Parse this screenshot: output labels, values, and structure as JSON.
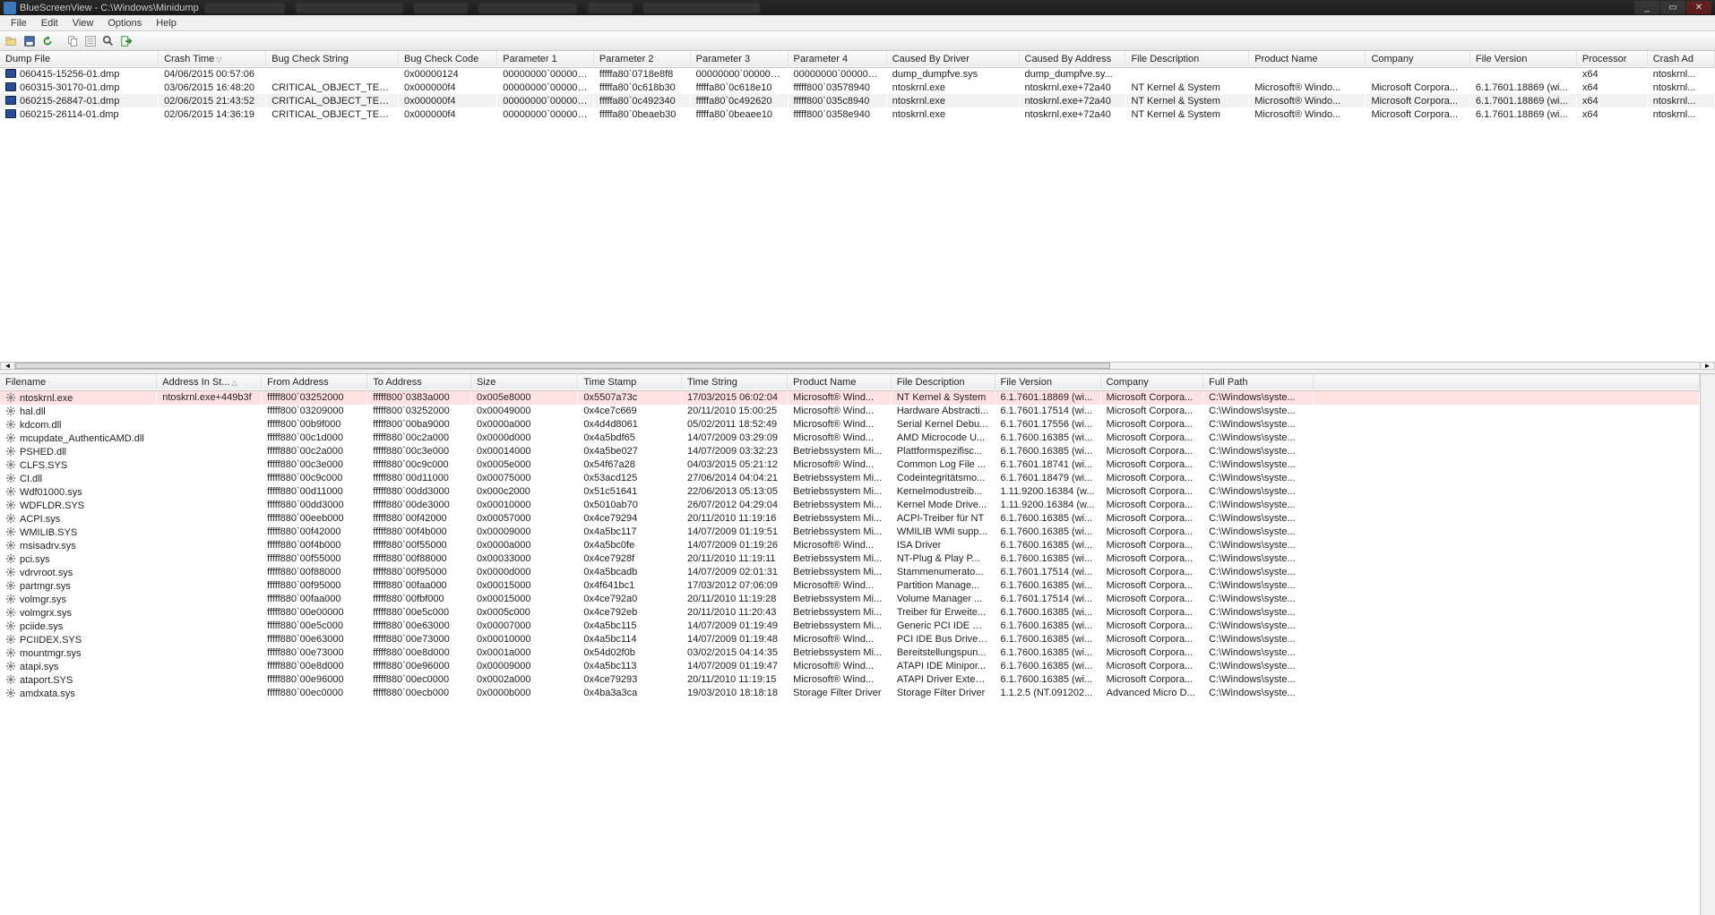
{
  "title": "BlueScreenView  -  C:\\Windows\\Minidump",
  "menu": [
    "File",
    "Edit",
    "View",
    "Options",
    "Help"
  ],
  "window_controls": {
    "min": "_",
    "max": "▭",
    "close": "✕"
  },
  "upper": {
    "columns": [
      "Dump File",
      "Crash Time",
      "Bug Check String",
      "Bug Check Code",
      "Parameter 1",
      "Parameter 2",
      "Parameter 3",
      "Parameter 4",
      "Caused By Driver",
      "Caused By Address",
      "File Description",
      "Product Name",
      "Company",
      "File Version",
      "Processor",
      "Crash Ad"
    ],
    "sort_col": 1,
    "rows": [
      [
        "060415-15256-01.dmp",
        "04/06/2015 00:57:06",
        "",
        "0x00000124",
        "00000000`000000...",
        "fffffa80`0718e8f8",
        "00000000`000000...",
        "00000000`000000...",
        "dump_dumpfve.sys",
        "dump_dumpfve.sy...",
        "",
        "",
        "",
        "",
        "x64",
        "ntoskrnl..."
      ],
      [
        "060315-30170-01.dmp",
        "03/06/2015 16:48:20",
        "CRITICAL_OBJECT_TER...",
        "0x000000f4",
        "00000000`000000...",
        "fffffa80`0c618b30",
        "fffffa80`0c618e10",
        "fffff800`03578940",
        "ntoskrnl.exe",
        "ntoskrnl.exe+72a40",
        "NT Kernel & System",
        "Microsoft® Windo...",
        "Microsoft Corpora...",
        "6.1.7601.18869 (wi...",
        "x64",
        "ntoskrnl..."
      ],
      [
        "060215-26847-01.dmp",
        "02/06/2015 21:43:52",
        "CRITICAL_OBJECT_TER...",
        "0x000000f4",
        "00000000`000000...",
        "fffffa80`0c492340",
        "fffffa80`0c492620",
        "fffff800`035c8940",
        "ntoskrnl.exe",
        "ntoskrnl.exe+72a40",
        "NT Kernel & System",
        "Microsoft® Windo...",
        "Microsoft Corpora...",
        "6.1.7601.18869 (wi...",
        "x64",
        "ntoskrnl..."
      ],
      [
        "060215-26114-01.dmp",
        "02/06/2015 14:36:19",
        "CRITICAL_OBJECT_TER...",
        "0x000000f4",
        "00000000`000000...",
        "fffffa80`0beaeb30",
        "fffffa80`0beaee10",
        "fffff800`0358e940",
        "ntoskrnl.exe",
        "ntoskrnl.exe+72a40",
        "NT Kernel & System",
        "Microsoft® Windo...",
        "Microsoft Corpora...",
        "6.1.7601.18869 (wi...",
        "x64",
        "ntoskrnl..."
      ]
    ],
    "selected": 2
  },
  "lower": {
    "columns": [
      "Filename",
      "Address In St...",
      "From Address",
      "To Address",
      "Size",
      "Time Stamp",
      "Time String",
      "Product Name",
      "File Description",
      "File Version",
      "Company",
      "Full Path"
    ],
    "sort_col": 1,
    "rows": [
      [
        "ntoskrnl.exe",
        "ntoskrnl.exe+449b3f",
        "fffff800`03252000",
        "fffff800`0383a000",
        "0x005e8000",
        "0x5507a73c",
        "17/03/2015 06:02:04",
        "Microsoft® Wind...",
        "NT Kernel & System",
        "6.1.7601.18869 (wi...",
        "Microsoft Corpora...",
        "C:\\Windows\\syste..."
      ],
      [
        "hal.dll",
        "",
        "fffff800`03209000",
        "fffff800`03252000",
        "0x00049000",
        "0x4ce7c669",
        "20/11/2010 15:00:25",
        "Microsoft® Wind...",
        "Hardware Abstracti...",
        "6.1.7601.17514 (wi...",
        "Microsoft Corpora...",
        "C:\\Windows\\syste..."
      ],
      [
        "kdcom.dll",
        "",
        "fffff800`00b9f000",
        "fffff800`00ba9000",
        "0x0000a000",
        "0x4d4d8061",
        "05/02/2011 18:52:49",
        "Microsoft® Wind...",
        "Serial Kernel Debu...",
        "6.1.7601.17556 (wi...",
        "Microsoft Corpora...",
        "C:\\Windows\\syste..."
      ],
      [
        "mcupdate_AuthenticAMD.dll",
        "",
        "fffff880`00c1d000",
        "fffff880`00c2a000",
        "0x0000d000",
        "0x4a5bdf65",
        "14/07/2009 03:29:09",
        "Microsoft® Wind...",
        "AMD Microcode U...",
        "6.1.7600.16385 (wi...",
        "Microsoft Corpora...",
        "C:\\Windows\\syste..."
      ],
      [
        "PSHED.dll",
        "",
        "fffff880`00c2a000",
        "fffff880`00c3e000",
        "0x00014000",
        "0x4a5be027",
        "14/07/2009 03:32:23",
        "Betriebssystem Mi...",
        "Plattformspezifisc...",
        "6.1.7600.16385 (wi...",
        "Microsoft Corpora...",
        "C:\\Windows\\syste..."
      ],
      [
        "CLFS.SYS",
        "",
        "fffff880`00c3e000",
        "fffff880`00c9c000",
        "0x0005e000",
        "0x54f67a28",
        "04/03/2015 05:21:12",
        "Microsoft® Wind...",
        "Common Log File ...",
        "6.1.7601.18741 (wi...",
        "Microsoft Corpora...",
        "C:\\Windows\\syste..."
      ],
      [
        "CI.dll",
        "",
        "fffff880`00c9c000",
        "fffff880`00d11000",
        "0x00075000",
        "0x53acd125",
        "27/06/2014 04:04:21",
        "Betriebssystem Mi...",
        "Codeintegritätsmo...",
        "6.1.7601.18479 (wi...",
        "Microsoft Corpora...",
        "C:\\Windows\\syste..."
      ],
      [
        "Wdf01000.sys",
        "",
        "fffff880`00d11000",
        "fffff880`00dd3000",
        "0x000c2000",
        "0x51c51641",
        "22/06/2013 05:13:05",
        "Betriebssystem Mi...",
        "Kernelmodustreib...",
        "1.11.9200.16384 (w...",
        "Microsoft Corpora...",
        "C:\\Windows\\syste..."
      ],
      [
        "WDFLDR.SYS",
        "",
        "fffff880`00dd3000",
        "fffff880`00de3000",
        "0x00010000",
        "0x5010ab70",
        "26/07/2012 04:29:04",
        "Betriebssystem Mi...",
        "Kernel Mode Drive...",
        "1.11.9200.16384 (w...",
        "Microsoft Corpora...",
        "C:\\Windows\\syste..."
      ],
      [
        "ACPI.sys",
        "",
        "fffff880`00eeb000",
        "fffff880`00f42000",
        "0x00057000",
        "0x4ce79294",
        "20/11/2010 11:19:16",
        "Betriebssystem Mi...",
        "ACPI-Treiber für NT",
        "6.1.7600.16385 (wi...",
        "Microsoft Corpora...",
        "C:\\Windows\\syste..."
      ],
      [
        "WMILIB.SYS",
        "",
        "fffff880`00f42000",
        "fffff880`00f4b000",
        "0x00009000",
        "0x4a5bc117",
        "14/07/2009 01:19:51",
        "Betriebssystem Mi...",
        "WMILIB WMI supp...",
        "6.1.7600.16385 (wi...",
        "Microsoft Corpora...",
        "C:\\Windows\\syste..."
      ],
      [
        "msisadrv.sys",
        "",
        "fffff880`00f4b000",
        "fffff880`00f55000",
        "0x0000a000",
        "0x4a5bc0fe",
        "14/07/2009 01:19:26",
        "Microsoft® Wind...",
        "ISA Driver",
        "6.1.7600.16385 (wi...",
        "Microsoft Corpora...",
        "C:\\Windows\\syste..."
      ],
      [
        "pci.sys",
        "",
        "fffff880`00f55000",
        "fffff880`00f88000",
        "0x00033000",
        "0x4ce7928f",
        "20/11/2010 11:19:11",
        "Betriebssystem Mi...",
        "NT-Plug & Play P...",
        "6.1.7600.16385 (wi...",
        "Microsoft Corpora...",
        "C:\\Windows\\syste..."
      ],
      [
        "vdrvroot.sys",
        "",
        "fffff880`00f88000",
        "fffff880`00f95000",
        "0x0000d000",
        "0x4a5bcadb",
        "14/07/2009 02:01:31",
        "Betriebssystem Mi...",
        "Stammenumerato...",
        "6.1.7601.17514 (wi...",
        "Microsoft Corpora...",
        "C:\\Windows\\syste..."
      ],
      [
        "partmgr.sys",
        "",
        "fffff880`00f95000",
        "fffff880`00faa000",
        "0x00015000",
        "0x4f641bc1",
        "17/03/2012 07:06:09",
        "Microsoft® Wind...",
        "Partition Manage...",
        "6.1.7600.16385 (wi...",
        "Microsoft Corpora...",
        "C:\\Windows\\syste..."
      ],
      [
        "volmgr.sys",
        "",
        "fffff880`00faa000",
        "fffff880`00fbf000",
        "0x00015000",
        "0x4ce792a0",
        "20/11/2010 11:19:28",
        "Betriebssystem Mi...",
        "Volume Manager ...",
        "6.1.7601.17514 (wi...",
        "Microsoft Corpora...",
        "C:\\Windows\\syste..."
      ],
      [
        "volmgrx.sys",
        "",
        "fffff880`00e00000",
        "fffff880`00e5c000",
        "0x0005c000",
        "0x4ce792eb",
        "20/11/2010 11:20:43",
        "Betriebssystem Mi...",
        "Treiber für Erweite...",
        "6.1.7600.16385 (wi...",
        "Microsoft Corpora...",
        "C:\\Windows\\syste..."
      ],
      [
        "pciide.sys",
        "",
        "fffff880`00e5c000",
        "fffff880`00e63000",
        "0x00007000",
        "0x4a5bc115",
        "14/07/2009 01:19:49",
        "Betriebssystem Mi...",
        "Generic PCI IDE Bu...",
        "6.1.7600.16385 (wi...",
        "Microsoft Corpora...",
        "C:\\Windows\\syste..."
      ],
      [
        "PCIIDEX.SYS",
        "",
        "fffff880`00e63000",
        "fffff880`00e73000",
        "0x00010000",
        "0x4a5bc114",
        "14/07/2009 01:19:48",
        "Microsoft® Wind...",
        "PCI IDE Bus Driver ...",
        "6.1.7600.16385 (wi...",
        "Microsoft Corpora...",
        "C:\\Windows\\syste..."
      ],
      [
        "mountmgr.sys",
        "",
        "fffff880`00e73000",
        "fffff880`00e8d000",
        "0x0001a000",
        "0x54d02f0b",
        "03/02/2015 04:14:35",
        "Betriebssystem Mi...",
        "Bereitstellungspun...",
        "6.1.7600.16385 (wi...",
        "Microsoft Corpora...",
        "C:\\Windows\\syste..."
      ],
      [
        "atapi.sys",
        "",
        "fffff880`00e8d000",
        "fffff880`00e96000",
        "0x00009000",
        "0x4a5bc113",
        "14/07/2009 01:19:47",
        "Microsoft® Wind...",
        "ATAPI IDE Minipor...",
        "6.1.7600.16385 (wi...",
        "Microsoft Corpora...",
        "C:\\Windows\\syste..."
      ],
      [
        "ataport.SYS",
        "",
        "fffff880`00e96000",
        "fffff880`00ec0000",
        "0x0002a000",
        "0x4ce79293",
        "20/11/2010 11:19:15",
        "Microsoft® Wind...",
        "ATAPI Driver Exten...",
        "6.1.7600.16385 (wi...",
        "Microsoft Corpora...",
        "C:\\Windows\\syste..."
      ],
      [
        "amdxata.sys",
        "",
        "fffff880`00ec0000",
        "fffff880`00ecb000",
        "0x0000b000",
        "0x4ba3a3ca",
        "19/03/2010 18:18:18",
        "Storage Filter Driver",
        "Storage Filter Driver",
        "1.1.2.5 (NT.091202...",
        "Advanced Micro D...",
        "C:\\Windows\\syste..."
      ]
    ]
  }
}
